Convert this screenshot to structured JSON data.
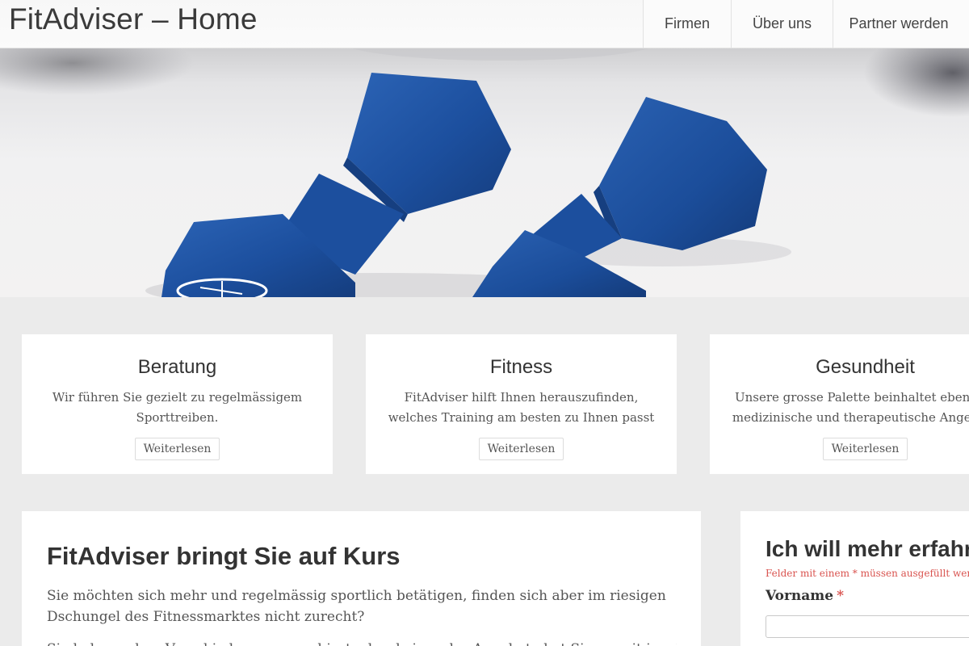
{
  "header": {
    "title": "FitAdviser – Home",
    "nav": [
      {
        "label": "Firmen"
      },
      {
        "label": "Über uns"
      },
      {
        "label": "Partner werden"
      }
    ]
  },
  "hero": {
    "image": "blue-dumbbells-photo",
    "accent_color": "#1c4f9e"
  },
  "features": [
    {
      "title": "Beratung",
      "text_lines": [
        "Wir führen Sie gezielt zu regelmässigem",
        "Sporttreiben."
      ],
      "button": "Weiterlesen"
    },
    {
      "title": "Fitness",
      "text_lines": [
        "FitAdviser hilft Ihnen herauszufinden,",
        "welches Training am besten zu Ihnen passt"
      ],
      "button": "Weiterlesen"
    },
    {
      "title": "Gesundheit",
      "text_lines": [
        "Unsere grosse Palette beinhaltet ebenfalls",
        "medizinische und therapeutische Angebote"
      ],
      "button": "Weiterlesen"
    }
  ],
  "main": {
    "heading": "FitAdviser bringt Sie auf Kurs",
    "paragraph_lines": [
      "Sie möchten sich mehr und regelmässig sportlich betätigen, finden sich aber im riesigen",
      "Dschungel des Fitnessmarktes nicht zurecht?"
    ],
    "paragraph2": "Sie haben schon Verschiedenes ausprobiert, aber keines der Angebote hat Sie soweit inspiriert"
  },
  "sidebar": {
    "heading": "Ich will mehr erfahren",
    "required_note": "Felder mit einem * müssen ausgefüllt werden",
    "fields": [
      {
        "label": "Vorname",
        "required_mark": "*",
        "value": ""
      }
    ]
  },
  "colors": {
    "required": "#d9534f",
    "page_background": "#ebebeb"
  }
}
